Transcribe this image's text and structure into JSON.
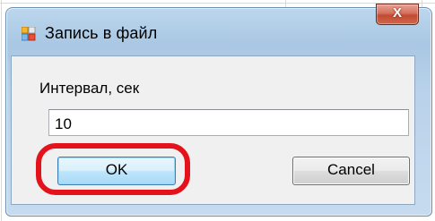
{
  "window": {
    "title": "Запись в файл",
    "close_label": "X"
  },
  "form": {
    "interval_label": "Интервал, сек",
    "interval_value": "10"
  },
  "buttons": {
    "ok_label": "OK",
    "cancel_label": "Cancel"
  },
  "annotation": {
    "highlight_color": "#e3121b"
  },
  "icons": {
    "app_icon": "app-window-icon",
    "close_icon": "close-icon"
  }
}
